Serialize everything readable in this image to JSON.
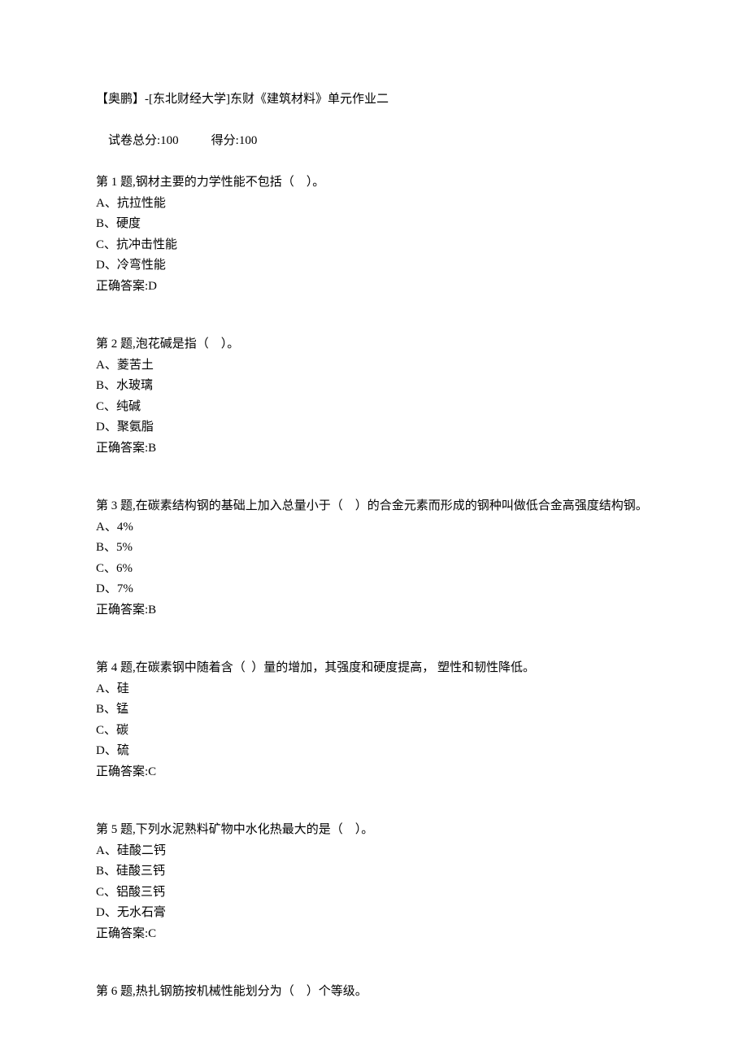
{
  "header": {
    "title": "【奥鹏】-[东北财经大学]东财《建筑材料》单元作业二",
    "total_label": "试卷总分:",
    "total_value": "100",
    "score_label": "得分:",
    "score_value": "100"
  },
  "questions": [
    {
      "prompt": "第 1 题,钢材主要的力学性能不包括（    ）。",
      "options": [
        "A、抗拉性能",
        "B、硬度",
        "C、抗冲击性能",
        "D、冷弯性能"
      ],
      "answer_label": "正确答案:",
      "answer": "D"
    },
    {
      "prompt": "第 2 题,泡花碱是指（    ）。",
      "options": [
        "A、菱苦土",
        "B、水玻璃",
        "C、纯碱",
        "D、聚氨脂"
      ],
      "answer_label": "正确答案:",
      "answer": "B"
    },
    {
      "prompt": "第 3 题,在碳素结构钢的基础上加入总量小于（    ）的合金元素而形成的钢种叫做低合金高强度结构钢。",
      "options": [
        "A、4%",
        "B、5%",
        "C、6%",
        "D、7%"
      ],
      "answer_label": "正确答案:",
      "answer": "B"
    },
    {
      "prompt": "第 4 题,在碳素钢中随着含（  ）量的增加，其强度和硬度提高， 塑性和韧性降低。",
      "options": [
        "A、硅",
        "B、锰",
        "C、碳",
        "D、硫"
      ],
      "answer_label": "正确答案:",
      "answer": "C"
    },
    {
      "prompt": "第 5 题,下列水泥熟料矿物中水化热最大的是（    ）。",
      "options": [
        "A、硅酸二钙",
        "B、硅酸三钙",
        "C、铝酸三钙",
        "D、无水石膏"
      ],
      "answer_label": "正确答案:",
      "answer": "C"
    },
    {
      "prompt": "第 6 题,热扎钢筋按机械性能划分为（    ）个等级。",
      "options": [],
      "answer_label": "",
      "answer": ""
    }
  ]
}
